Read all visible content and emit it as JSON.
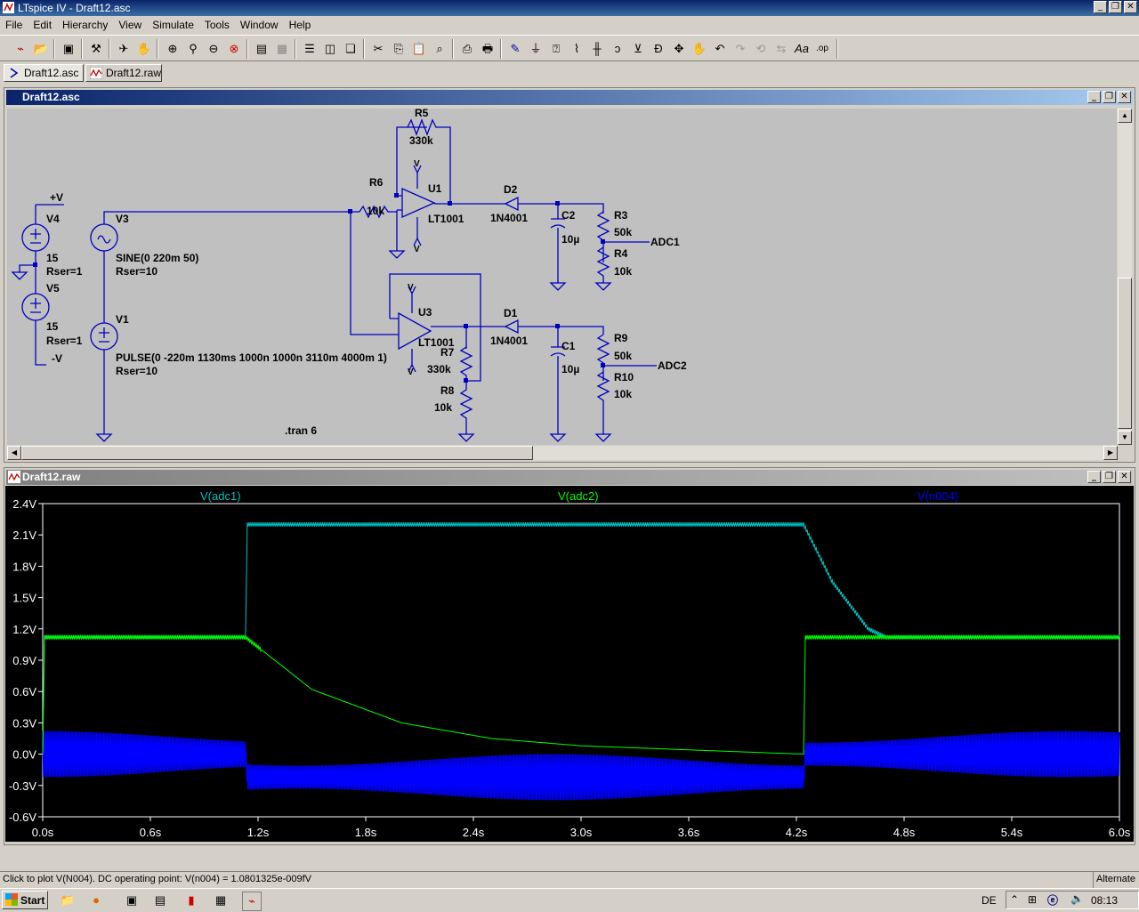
{
  "app": {
    "title": "LTspice IV - Draft12.asc"
  },
  "menu": [
    "File",
    "Edit",
    "Hierarchy",
    "View",
    "Simulate",
    "Tools",
    "Window",
    "Help"
  ],
  "tabs": [
    {
      "label": "Draft12.asc",
      "active": true
    },
    {
      "label": "Draft12.raw",
      "active": false
    }
  ],
  "schematic": {
    "title": "Draft12.asc",
    "labels": {
      "r5": "R5",
      "r5v": "330k",
      "r6": "R6",
      "r6v": "10k",
      "u1": "U1",
      "u1m": "LT1001",
      "u3": "U3",
      "u3m": "LT1001",
      "d2": "D2",
      "d2m": "1N4001",
      "d1": "D1",
      "d1m": "1N4001",
      "c2": "C2",
      "c2v": "10µ",
      "c1": "C1",
      "c1v": "10µ",
      "r3": "R3",
      "r3v": "50k",
      "r4": "R4",
      "r4v": "10k",
      "r9": "R9",
      "r9v": "50k",
      "r10": "R10",
      "r10v": "10k",
      "r7": "R7",
      "r7v": "330k",
      "r8": "R8",
      "r8v": "10k",
      "adc1": "ADC1",
      "adc2": "ADC2",
      "pv": "+V",
      "mv": "-V",
      "v4": "V4",
      "v4a": "15",
      "v4b": "Rser=1",
      "v5": "V5",
      "v5a": "15",
      "v5b": "Rser=1",
      "v3": "V3",
      "v3a": "SINE(0 220m 50)",
      "v3b": "Rser=10",
      "v1": "V1",
      "v1a": "PULSE(0 -220m 1130ms 1000n 1000n 3110m 4000m 1)",
      "v1b": "Rser=10",
      "tran": ".tran 6",
      "vpos": "V",
      "vneg": "V"
    }
  },
  "plot": {
    "title": "Draft12.raw",
    "traces": [
      {
        "name": "V(adc1)",
        "color": "#00c0c0"
      },
      {
        "name": "V(adc2)",
        "color": "#00ff00"
      },
      {
        "name": "V(n004)",
        "color": "#0000ff"
      }
    ]
  },
  "chart_data": {
    "type": "line",
    "title": "",
    "xlabel": "",
    "ylabel": "",
    "xlim": [
      0.0,
      6.0
    ],
    "ylim": [
      -0.6,
      2.4
    ],
    "x_ticks": [
      "0.0s",
      "0.6s",
      "1.2s",
      "1.8s",
      "2.4s",
      "3.0s",
      "3.6s",
      "4.2s",
      "4.8s",
      "5.4s",
      "6.0s"
    ],
    "y_ticks": [
      "2.4V",
      "2.1V",
      "1.8V",
      "1.5V",
      "1.2V",
      "0.9V",
      "0.6V",
      "0.3V",
      "0.0V",
      "-0.3V",
      "-0.6V"
    ],
    "background": "#000000",
    "series": [
      {
        "name": "V(adc1)",
        "x": [
          0.0,
          0.01,
          1.13,
          1.14,
          4.24,
          4.4,
          4.6,
          4.7,
          6.0
        ],
        "values": [
          0.0,
          1.12,
          1.12,
          2.2,
          2.2,
          1.65,
          1.2,
          1.12,
          1.12
        ]
      },
      {
        "name": "V(adc2)",
        "x": [
          0.0,
          0.01,
          1.13,
          1.5,
          2.0,
          2.5,
          3.0,
          4.24,
          4.25,
          6.0
        ],
        "values": [
          0.0,
          1.12,
          1.12,
          0.62,
          0.3,
          0.15,
          0.08,
          0.0,
          1.12,
          1.12
        ]
      },
      {
        "name": "V(n004)",
        "x": [
          0.0,
          1.13,
          1.14,
          4.24,
          4.25,
          6.0
        ],
        "values_center": [
          0.0,
          0.0,
          -0.22,
          -0.22,
          0.0,
          0.0
        ],
        "amplitude": 0.22
      }
    ]
  },
  "status": {
    "message": "Click to plot V(N004).  DC operating point: V(n004) = 1.0801325e-009fV",
    "mode": "Alternate"
  },
  "taskbar": {
    "start": "Start",
    "lang": "DE",
    "time": "08:13"
  }
}
